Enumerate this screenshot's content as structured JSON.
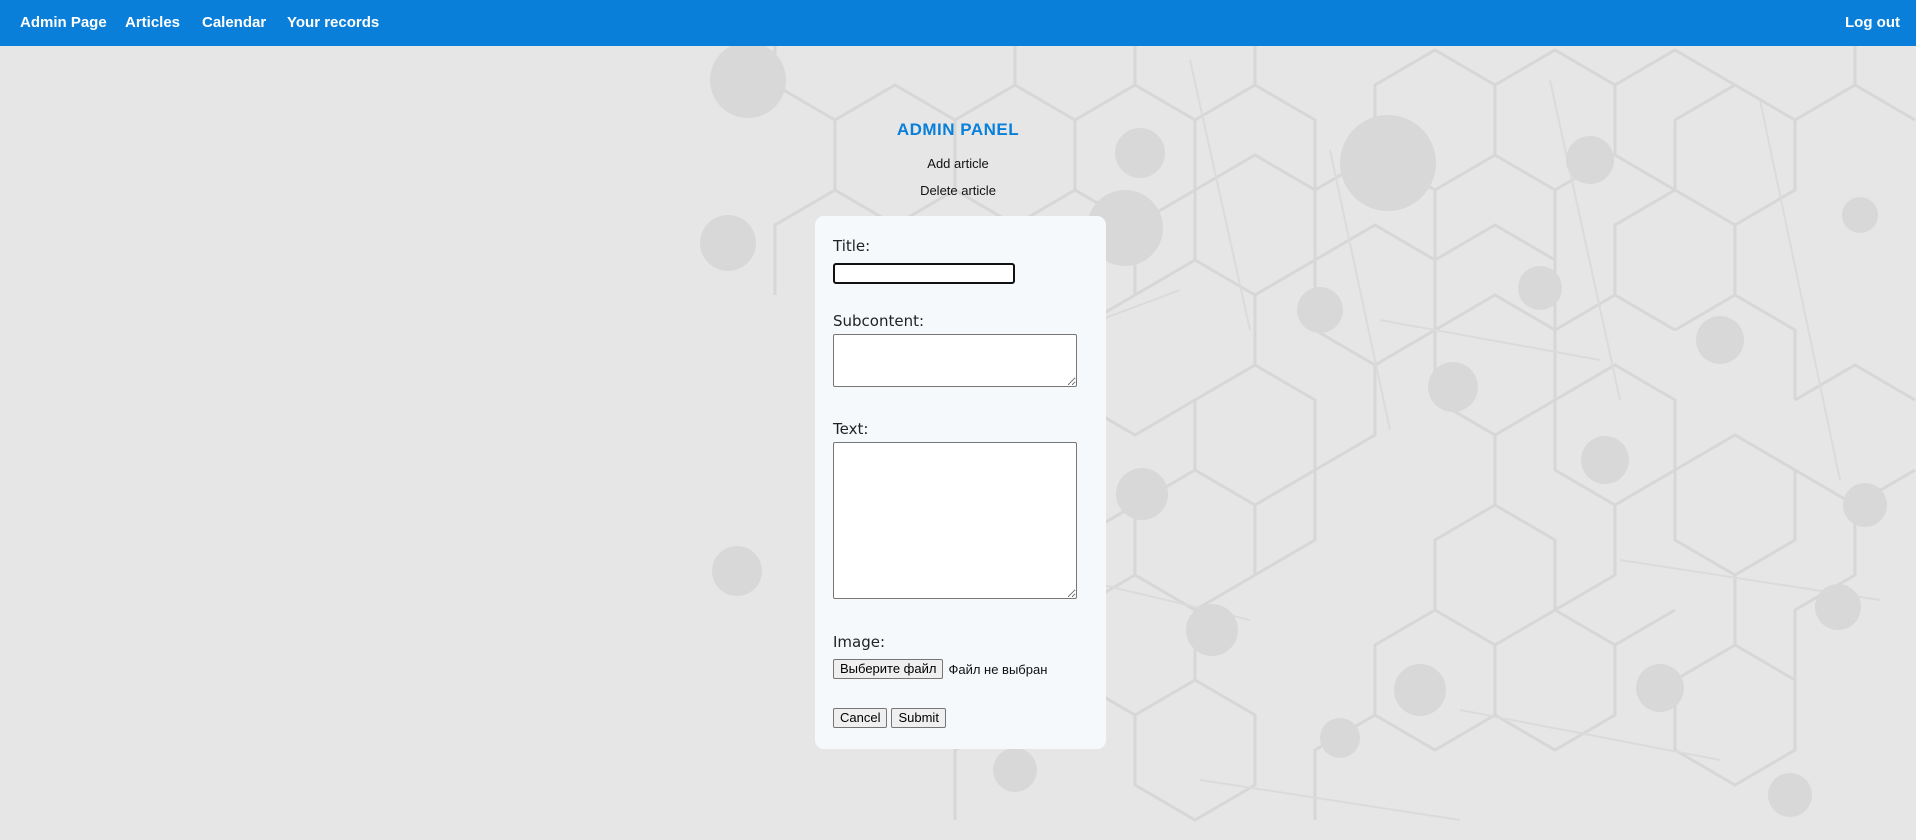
{
  "nav": {
    "admin_page": "Admin Page",
    "articles": "Articles",
    "calendar": "Calendar",
    "your_records": "Your records",
    "log_out": "Log out"
  },
  "panel": {
    "title": "ADMIN PANEL",
    "add_article": "Add article",
    "delete_article": "Delete article"
  },
  "form": {
    "title_label": "Title:",
    "title_value": "",
    "subcontent_label": "Subcontent:",
    "subcontent_value": "",
    "text_label": "Text:",
    "text_value": "",
    "image_label": "Image:",
    "choose_file_button": "Выберите файл",
    "file_status": "Файл не выбран",
    "cancel_button": "Cancel",
    "submit_button": "Submit"
  },
  "colors": {
    "accent": "#0a7fd9",
    "background": "#e6e6e6",
    "card": "#f5f9fc"
  }
}
